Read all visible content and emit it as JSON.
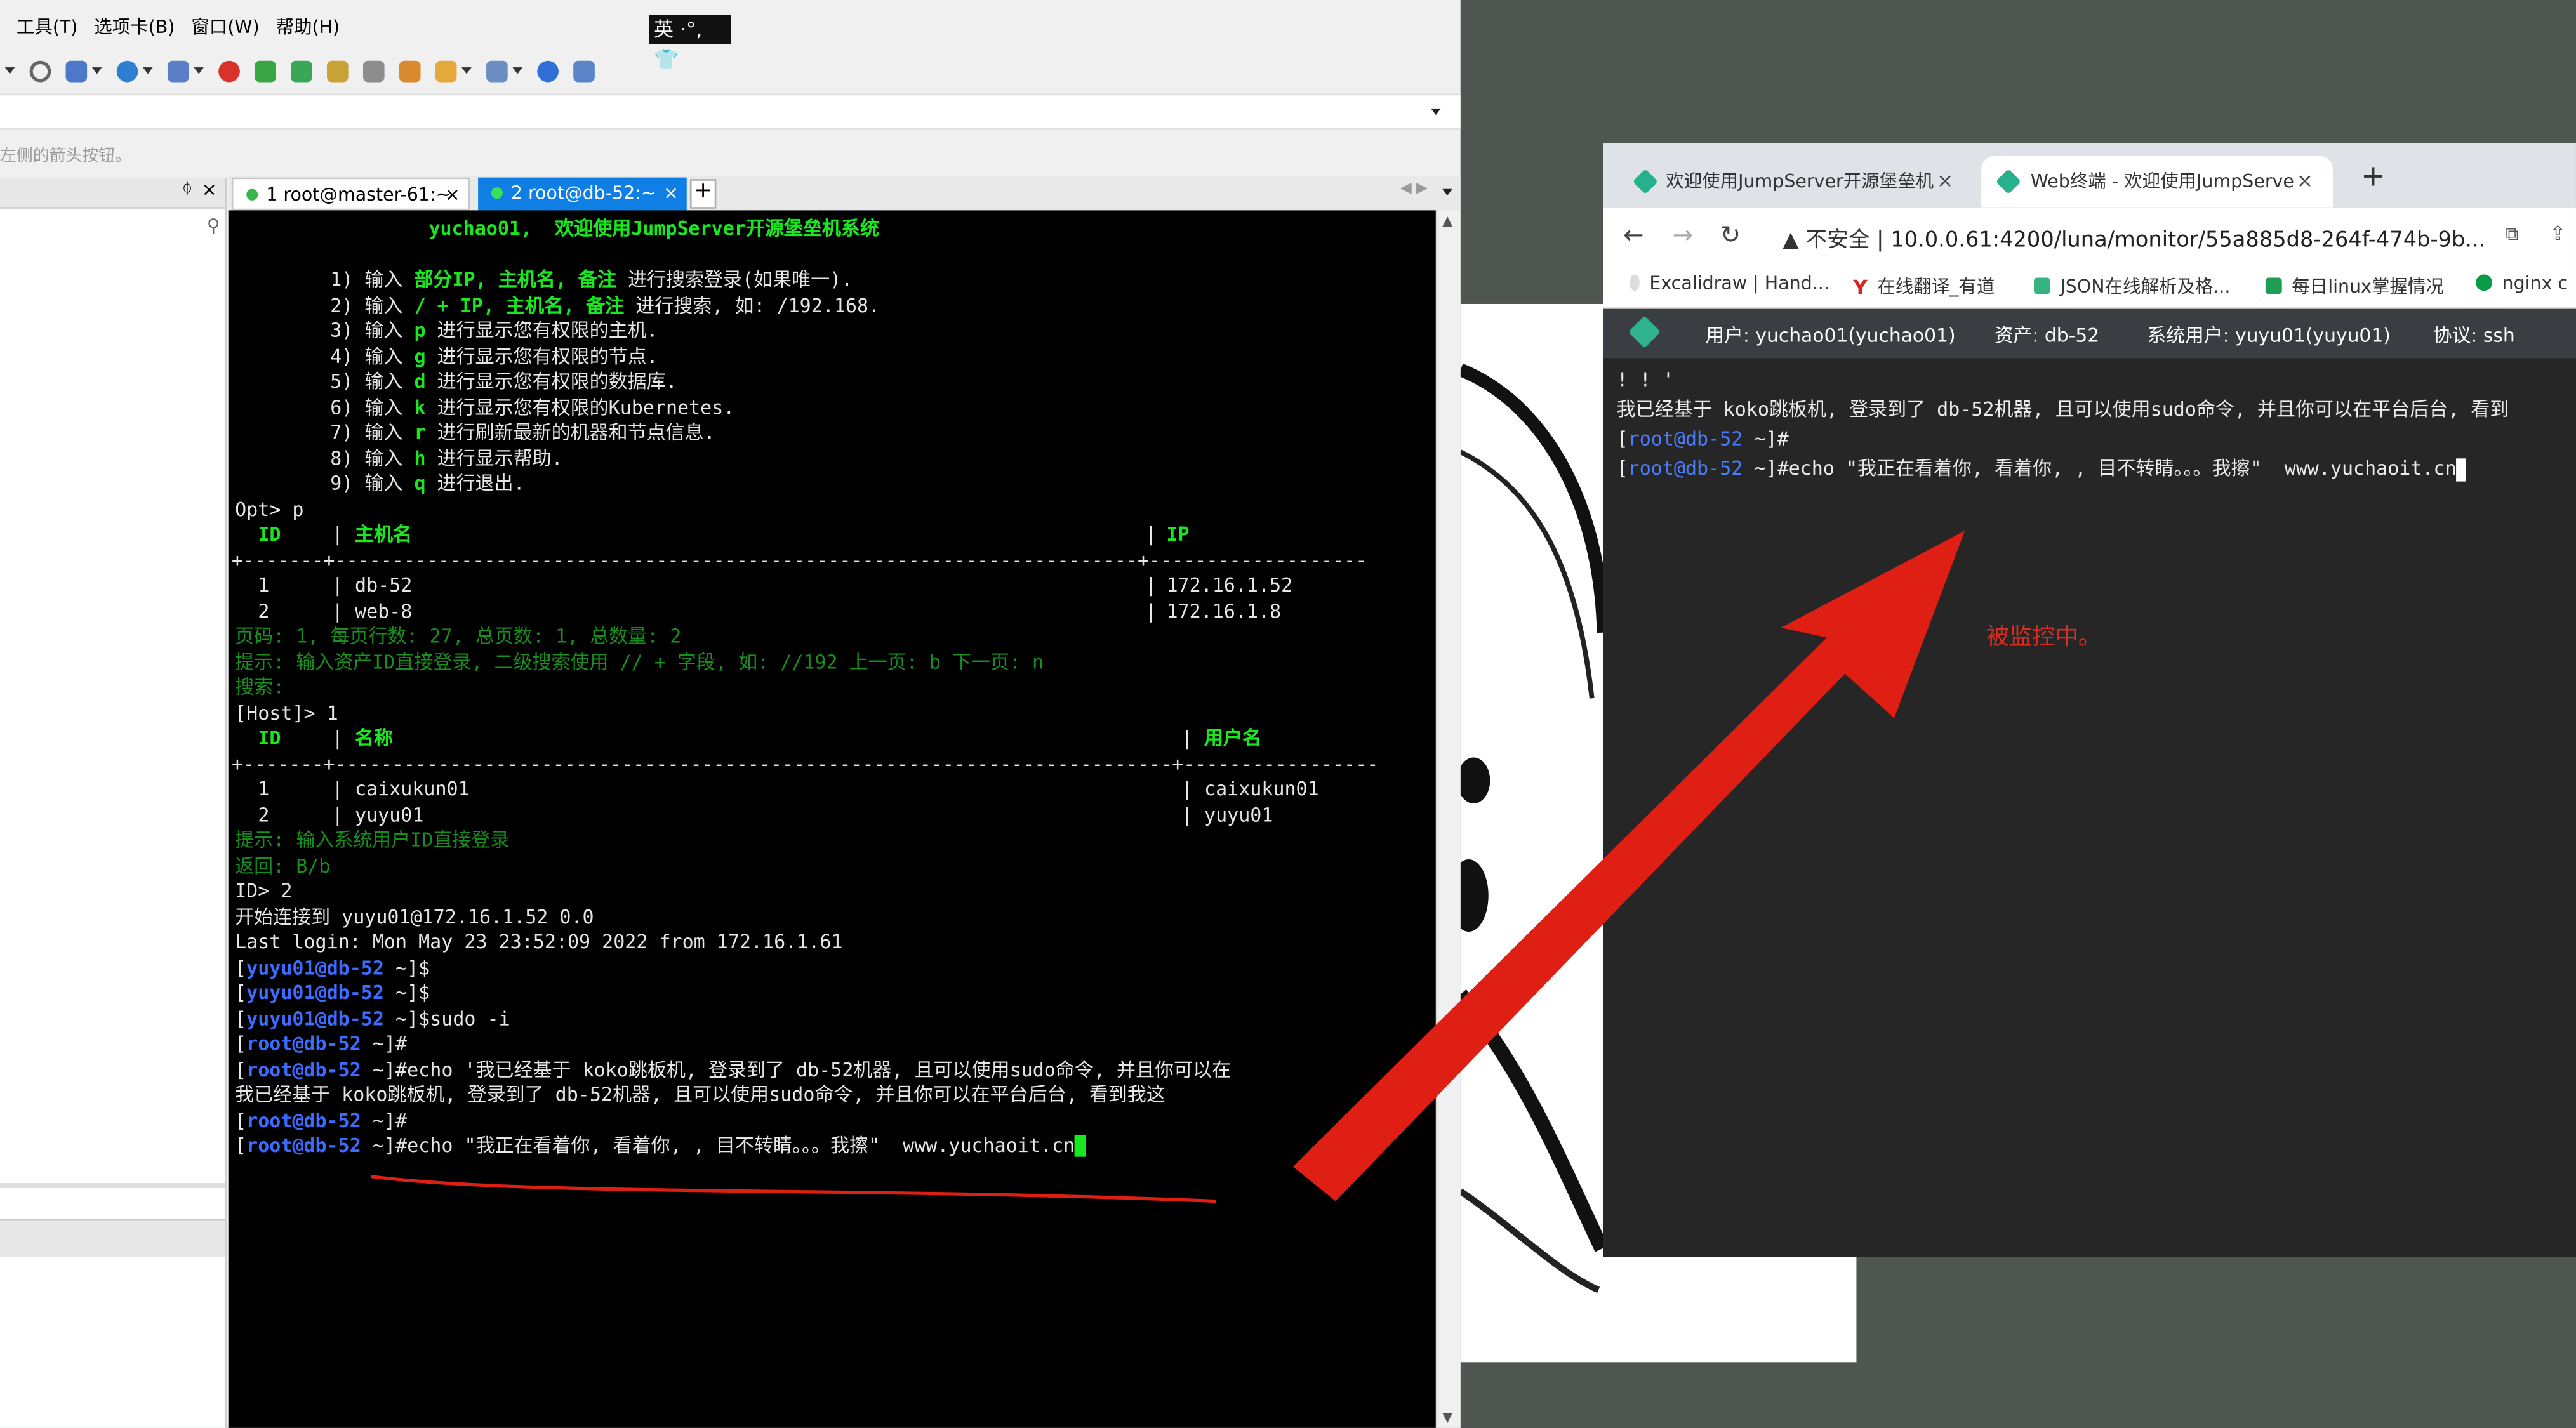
{
  "xshell": {
    "menu": [
      "工具(T)",
      "选项卡(B)",
      "窗口(W)",
      "帮助(H)"
    ],
    "ime": "英 ·°, 👕",
    "hint": "左侧的箭头按钮。",
    "tabs": [
      {
        "label": "1 root@master-61:~",
        "close": "×"
      },
      {
        "label": "2 root@db-52:~",
        "close": "×"
      }
    ],
    "tab_plus": "+",
    "pane": {
      "pin": "ᛰ",
      "close": "×"
    }
  },
  "terminal": {
    "welcome": "yuchao01,  欢迎使用JumpServer开源堡垒机系统",
    "menu_lines": [
      {
        "num": "1) 输入 ",
        "key": "部分IP, 主机名, 备注",
        "rest": " 进行搜索登录(如果唯一)."
      },
      {
        "num": "2) 输入 ",
        "key": "/ + IP, 主机名, 备注",
        "rest": " 进行搜索, 如: /192.168."
      },
      {
        "num": "3) 输入 ",
        "key": "p",
        "rest": " 进行显示您有权限的主机."
      },
      {
        "num": "4) 输入 ",
        "key": "g",
        "rest": " 进行显示您有权限的节点."
      },
      {
        "num": "5) 输入 ",
        "key": "d",
        "rest": " 进行显示您有权限的数据库."
      },
      {
        "num": "6) 输入 ",
        "key": "k",
        "rest": " 进行显示您有权限的Kubernetes."
      },
      {
        "num": "7) 输入 ",
        "key": "r",
        "rest": " 进行刷新最新的机器和节点信息."
      },
      {
        "num": "8) 输入 ",
        "key": "h",
        "rest": " 进行显示帮助."
      },
      {
        "num": "9) 输入 ",
        "key": "q",
        "rest": " 进行退出."
      }
    ],
    "opt_prompt": "Opt> p",
    "host_table": {
      "headers": [
        "ID",
        "主机名",
        "IP"
      ],
      "rows": [
        {
          "id": "1",
          "name": "db-52",
          "ip": "172.16.1.52"
        },
        {
          "id": "2",
          "name": "web-8",
          "ip": "172.16.1.8"
        }
      ]
    },
    "paging": "页码: 1, 每页行数: 27, 总页数: 1, 总数量: 2",
    "tip1": "提示: 输入资产ID直接登录, 二级搜索使用 // + 字段, 如: //192 上一页: b 下一页: n",
    "search": "搜索:",
    "host_prompt": "[Host]> 1",
    "user_table": {
      "headers": [
        "ID",
        "名称",
        "用户名"
      ],
      "rows": [
        {
          "id": "1",
          "name": "caixukun01",
          "user": "caixukun01"
        },
        {
          "id": "2",
          "name": "yuyu01",
          "user": "yuyu01"
        }
      ]
    },
    "tip2": "提示: 输入系统用户ID直接登录",
    "back": "返回: B/b",
    "id_prompt": "ID> 2",
    "connecting": "开始连接到 yuyu01@172.16.1.52 0.0",
    "last_login": "Last login: Mon May 23 23:52:09 2022 from 172.16.1.61",
    "prompt_user": "yuyu01@db-52",
    "prompt_root": "root@db-52",
    "cmd_sudo": "sudo -i",
    "cmd_echo1": "#echo '我已经基于 koko跳板机, 登录到了 db-52机器, 且可以使用sudo命令, 并且你可以在",
    "echo1_out": "我已经基于 koko跳板机, 登录到了 db-52机器, 且可以使用sudo命令, 并且你可以在平台后台, 看到我这",
    "cmd_echo2": "#echo \"我正在看着你, 看着你, , 目不转睛。。。我擦\"  www.yuchaoit.cn"
  },
  "browser": {
    "tabs": [
      {
        "label": "欢迎使用JumpServer开源堡垒机",
        "close": "×"
      },
      {
        "label": "Web终端 - 欢迎使用JumpServe",
        "close": "×"
      }
    ],
    "new_tab": "+",
    "insecure": "▲ 不安全 |",
    "url": "10.0.0.61:4200/luna/monitor/55a885d8-264f-474b-9b...",
    "bookmarks": [
      "Excalidraw | Hand...",
      "在线翻译_有道",
      "JSON在线解析及格...",
      "每日linux掌握情况",
      "nginx c"
    ],
    "session": {
      "user": "用户: yuchao01(yuchao01)",
      "asset": "资产: db-52",
      "sysuser": "系统用户: yuyu01(yuyu01)",
      "protocol": "协议: ssh"
    },
    "term": {
      "line1": "! ! '",
      "line2": "我已经基于 koko跳板机, 登录到了 db-52机器, 且可以使用sudo命令, 并且你可以在平台后台, 看到",
      "prompt": "root@db-52",
      "cmd2": "#echo \"我正在看着你, 看着你, , 目不转睛。。。我擦\"  www.yuchaoit.cn"
    }
  },
  "annotation": "被监控中。",
  "colors": {
    "terminal_green": "#18e91f",
    "prompt_blue": "#3b6bff",
    "arrow_red": "#e01f14",
    "tab_active": "#0f7fe6"
  }
}
